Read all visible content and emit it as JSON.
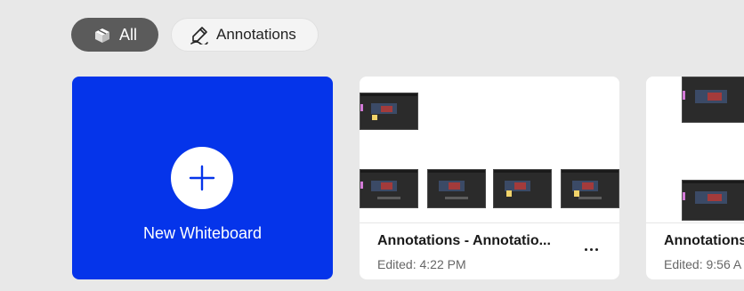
{
  "filters": {
    "all_label": "All",
    "annotations_label": "Annotations"
  },
  "new_whiteboard": {
    "label": "New Whiteboard"
  },
  "boards": [
    {
      "title": "Annotations - Annotatio...",
      "edited": "Edited: 4:22 PM"
    },
    {
      "title": "Annotations - A",
      "edited": "Edited: 9:56 A"
    }
  ],
  "icons": {
    "all": "boxes-icon",
    "annotations": "pen-icon",
    "new": "plus-icon",
    "more": "more-icon"
  },
  "colors": {
    "accent": "#0534ea",
    "chip_active": "#5b5b5b",
    "background": "#e8e8e8"
  }
}
